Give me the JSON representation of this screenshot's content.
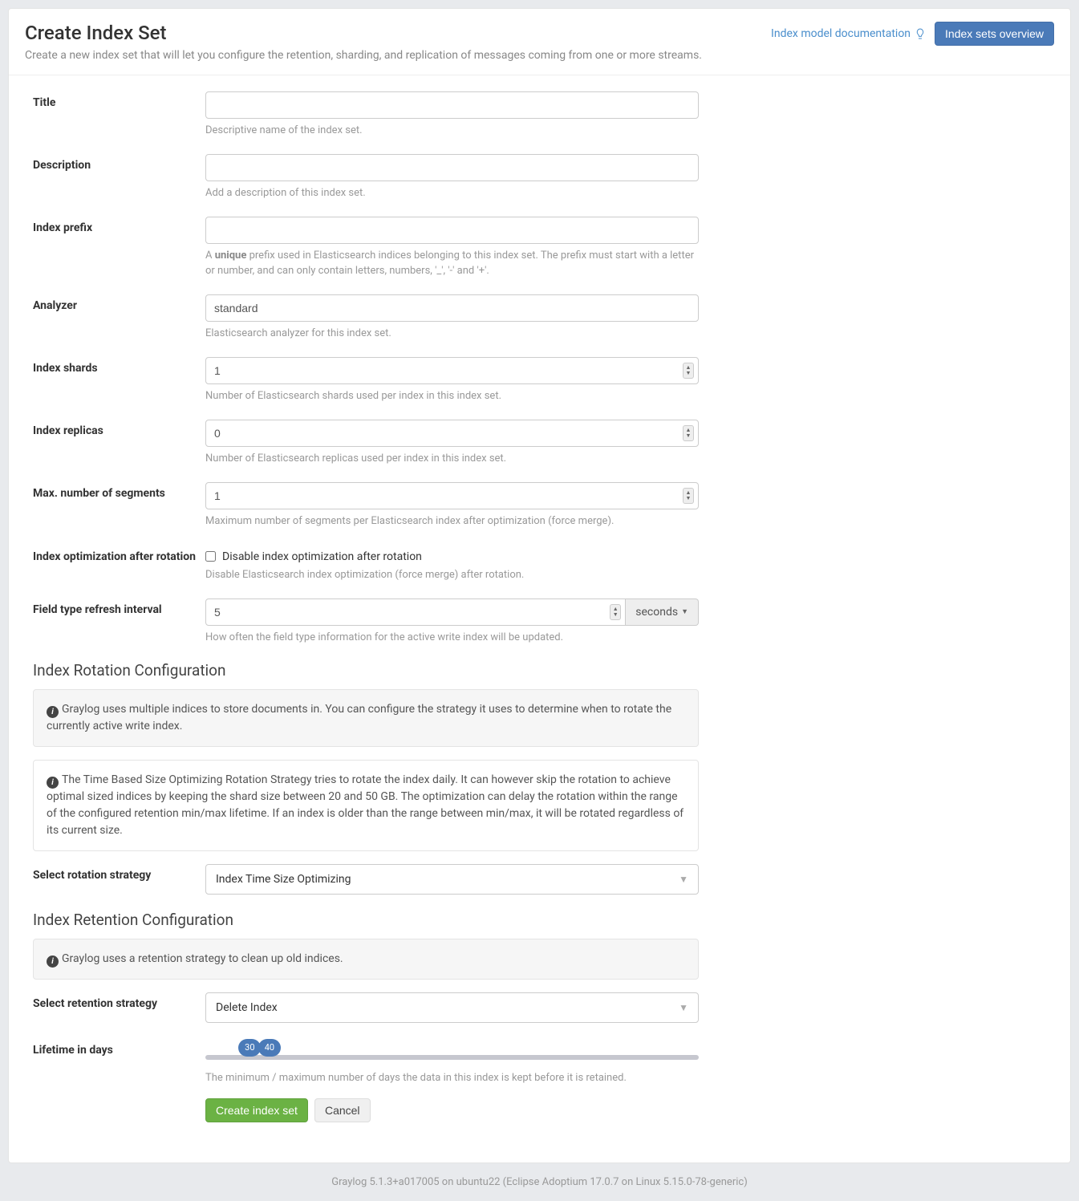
{
  "header": {
    "title": "Create Index Set",
    "subtitle": "Create a new index set that will let you configure the retention, sharding, and replication of messages coming from one or more streams.",
    "doc_link": "Index model documentation",
    "overview_button": "Index sets overview"
  },
  "fields": {
    "title": {
      "label": "Title",
      "value": "",
      "help": "Descriptive name of the index set."
    },
    "description": {
      "label": "Description",
      "value": "",
      "help": "Add a description of this index set."
    },
    "index_prefix": {
      "label": "Index prefix",
      "value": "",
      "help_prefix": "A ",
      "help_bold": "unique",
      "help_suffix": " prefix used in Elasticsearch indices belonging to this index set. The prefix must start with a letter or number, and can only contain letters, numbers, '_', '-' and '+'."
    },
    "analyzer": {
      "label": "Analyzer",
      "value": "standard",
      "help": "Elasticsearch analyzer for this index set."
    },
    "index_shards": {
      "label": "Index shards",
      "value": "1",
      "help": "Number of Elasticsearch shards used per index in this index set."
    },
    "index_replicas": {
      "label": "Index replicas",
      "value": "0",
      "help": "Number of Elasticsearch replicas used per index in this index set."
    },
    "max_segments": {
      "label": "Max. number of segments",
      "value": "1",
      "help": "Maximum number of segments per Elasticsearch index after optimization (force merge)."
    },
    "optimization": {
      "label": "Index optimization after rotation",
      "checkbox_label": "Disable index optimization after rotation",
      "help": "Disable Elasticsearch index optimization (force merge) after rotation."
    },
    "refresh_interval": {
      "label": "Field type refresh interval",
      "value": "5",
      "unit": "seconds",
      "help": "How often the field type information for the active write index will be updated."
    }
  },
  "rotation": {
    "section_title": "Index Rotation Configuration",
    "info1": "Graylog uses multiple indices to store documents in. You can configure the strategy it uses to determine when to rotate the currently active write index.",
    "info2": "The Time Based Size Optimizing Rotation Strategy tries to rotate the index daily. It can however skip the rotation to achieve optimal sized indices by keeping the shard size between 20 and 50 GB. The optimization can delay the rotation within the range of the configured retention min/max lifetime. If an index is older than the range between min/max, it will be rotated regardless of its current size.",
    "select_label": "Select rotation strategy",
    "select_value": "Index Time Size Optimizing"
  },
  "retention": {
    "section_title": "Index Retention Configuration",
    "info": "Graylog uses a retention strategy to clean up old indices.",
    "select_label": "Select retention strategy",
    "select_value": "Delete Index",
    "lifetime_label": "Lifetime in days",
    "lifetime_min": "30",
    "lifetime_max": "40",
    "lifetime_help": "The minimum / maximum number of days the data in this index is kept before it is retained."
  },
  "actions": {
    "submit": "Create index set",
    "cancel": "Cancel"
  },
  "footer": "Graylog 5.1.3+a017005 on ubuntu22 (Eclipse Adoptium 17.0.7 on Linux 5.15.0-78-generic)"
}
